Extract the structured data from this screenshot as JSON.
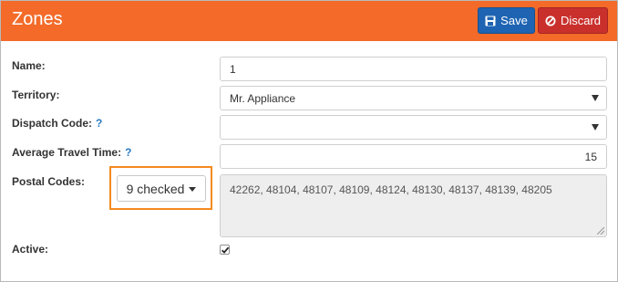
{
  "header": {
    "title": "Zones",
    "save_label": "Save",
    "discard_label": "Discard"
  },
  "form": {
    "name": {
      "label": "Name:",
      "value": "1"
    },
    "territory": {
      "label": "Territory:",
      "value": "Mr. Appliance"
    },
    "dispatch_code": {
      "label": "Dispatch Code:",
      "help": "?",
      "value": ""
    },
    "avg_travel_time": {
      "label": "Average Travel Time:",
      "help": "?",
      "value": "15"
    },
    "postal_codes": {
      "label": "Postal Codes:",
      "dropdown_label": "9 checked",
      "value": "42262, 48104, 48107, 48109, 48124, 48130, 48137, 48139, 48205"
    },
    "active": {
      "label": "Active:",
      "checked": true
    }
  },
  "colors": {
    "header": "#f36a29",
    "save": "#1f64b3",
    "discard": "#c9302c",
    "highlight": "#f4891f",
    "help": "#2a7bc0"
  },
  "icons": {
    "save": "floppy-disk-icon",
    "discard": "ban-circle-icon",
    "select": "chevron-down-icon",
    "dropdown": "caret-down-icon",
    "check": "check-icon"
  }
}
